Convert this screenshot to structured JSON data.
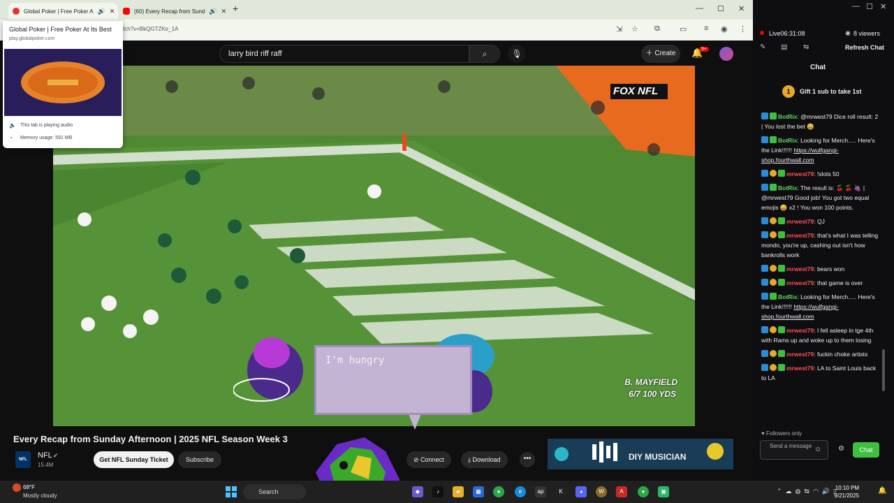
{
  "tabs": [
    {
      "title": "Global Poker | Free Poker A",
      "favicon_color": "#e8332a"
    },
    {
      "title": "(60) Every Recap from Sund",
      "favicon_color": "#ff0000"
    }
  ],
  "address": {
    "visible_text": "tch?v=BkQGTZKe_1A"
  },
  "hover_card": {
    "title": "Global Poker | Free Poker At Its Best",
    "url": "play.globalpoker.com",
    "audio_text": "This tab is playing audio",
    "memory_text": "Memory usage: 591 MB"
  },
  "youtube": {
    "search_value": "larry bird riff raff",
    "create_label": "Create",
    "notification_count": "9+",
    "network_logo": "FOX NFL",
    "stat_name": "B. MAYFIELD",
    "stat_line": "6/7 100 YDS",
    "speech_text": "I'm hungry",
    "video_title": "Every Recap from Sunday Afternoon | 2025 NFL Season Week 3",
    "channel_name": "NFL",
    "channel_logo": "NFL",
    "channel_subs": "15.4M",
    "ticket_label": "Get NFL Sunday Ticket",
    "subscribe_label": "Subscribe",
    "connect_label": "Connect",
    "download_label": "Download",
    "more_label": "•••",
    "ad_text": "DIY MUSICIAN"
  },
  "stream": {
    "live_time": "Live06:31:08",
    "viewers": "8 viewers",
    "refresh_label": "Refresh Chat",
    "chat_title": "Chat",
    "gift_count": "1",
    "gift_text": "Gift 1 sub to take 1st",
    "messages": [
      {
        "user": "BotRix",
        "text": "@mrwest79 Dice roll result: 2 | You lost the bet 😄",
        "bot": true
      },
      {
        "user": "BotRix",
        "text": "Looking for Merch..... Here's the Link!!!!!! ",
        "link": "https://wulfgangi-shop.fourthwall.com",
        "bot": true
      },
      {
        "user": "mrwest79",
        "text": "!slots 50",
        "bot": false
      },
      {
        "user": "BotRix",
        "text": "The result is: 🍒 🍒 🍇 | @mrwest79 Good job! You got two equal emojis 😄 x2 ! You won 100 points.",
        "bot": true
      },
      {
        "user": "mrwest79",
        "text": "QJ",
        "bot": false
      },
      {
        "user": "mrwest79",
        "text": "that's what I was telling mondo, you're up, cashing out isn't how bankrolls work",
        "bot": false
      },
      {
        "user": "mrwest79",
        "text": "bears won",
        "bot": false
      },
      {
        "user": "mrwest79",
        "text": "that game is over",
        "bot": false
      },
      {
        "user": "BotRix",
        "text": "Looking for Merch..... Here's the Link!!!!!! ",
        "link": "https://wulfgangi-shop.fourthwall.com",
        "bot": true
      },
      {
        "user": "mrwest79",
        "text": "I fell asleep in tge 4th with Rams up and woke up to them losing",
        "bot": false
      },
      {
        "user": "mrwest79",
        "text": "fuckin choke artists",
        "bot": false
      },
      {
        "user": "mrwest79",
        "text": "LA to Saint Louis back to LA",
        "bot": false
      }
    ],
    "followers_only": "Followers only",
    "input_placeholder": "Send a message",
    "send_label": "Chat"
  },
  "taskbar": {
    "temp": "68°F",
    "weather": "Mostly cloudy",
    "search_label": "Search",
    "time": "10:10 PM",
    "date": "9/21/2025"
  },
  "colors": {
    "accent_green": "#3fbf3f",
    "live_red": "#eb0400",
    "chat_user_red": "#ff5050"
  }
}
